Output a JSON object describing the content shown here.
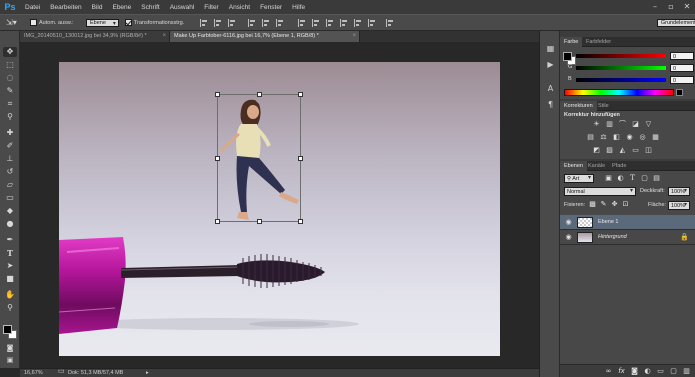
{
  "app": {
    "logo": "Ps",
    "menu": [
      "Datei",
      "Bearbeiten",
      "Bild",
      "Ebene",
      "Schrift",
      "Auswahl",
      "Filter",
      "Ansicht",
      "Fenster",
      "Hilfe"
    ],
    "window_controls": {
      "minimize": "–",
      "maximize": "▫",
      "close": "✕"
    }
  },
  "options_bar": {
    "auto_select_label": "Autom. ausw.:",
    "auto_select_checked": false,
    "auto_select_target": "Ebene",
    "transform_controls_label": "Transformationsstrg.",
    "transform_controls_checked": true,
    "workspace": "Grundelemente"
  },
  "tabs": [
    {
      "label": "IMG_20140510_130012.jpg bei 34,9% (RGB/8#) *",
      "close": "×",
      "active": false
    },
    {
      "label": "Make Up Farbtober-6116.jpg bei 16,7% (Ebene 1, RGB/8) *",
      "close": "×",
      "active": true
    }
  ],
  "status": {
    "zoom": "16,67%",
    "doc_info": "Dok: 51,3 MB/57,4 MB"
  },
  "color_panel": {
    "tabs": [
      "Farbe",
      "Farbfelder"
    ],
    "channels": [
      {
        "label": "R",
        "value": "0",
        "color": "#cc2222"
      },
      {
        "label": "G",
        "value": "0",
        "color": "#22aa22"
      },
      {
        "label": "B",
        "value": "0",
        "color": "#2244cc"
      }
    ]
  },
  "adjustments_panel": {
    "tabs": [
      "Korrekturen",
      "Stile"
    ],
    "title": "Korrektur hinzufügen",
    "row1": [
      "brightness-icon",
      "levels-icon",
      "curves-icon",
      "exposure-icon",
      "vibrance-icon"
    ],
    "row2": [
      "hue-saturation-icon",
      "color-balance-icon",
      "black-white-icon",
      "photo-filter-icon",
      "channel-mixer-icon",
      "color-lookup-icon"
    ],
    "row3": [
      "invert-icon",
      "posterize-icon",
      "threshold-icon",
      "gradient-map-icon",
      "selective-color-icon"
    ]
  },
  "layers_panel": {
    "tabs": [
      "Ebenen",
      "Kanäle",
      "Pfade"
    ],
    "filter_kind": "Art",
    "blend_mode": "Normal",
    "opacity_label": "Deckkraft:",
    "opacity_value": "100%",
    "lock_label": "Fixieren:",
    "fill_label": "Fläche:",
    "fill_value": "100%",
    "layers": [
      {
        "name": "Ebene 1",
        "selected": true,
        "locked": false
      },
      {
        "name": "Hintergrund",
        "selected": false,
        "locked": true
      }
    ],
    "footer_icons": [
      "link-icon",
      "fx-icon",
      "mask-icon",
      "adjustment-layer-icon",
      "group-icon",
      "new-layer-icon",
      "trash-icon"
    ]
  },
  "toolbar": {
    "tools": [
      "move-tool",
      "marquee-tool",
      "lasso-tool",
      "quick-select-tool",
      "crop-tool",
      "eyedropper-tool",
      "healing-brush-tool",
      "brush-tool",
      "clone-stamp-tool",
      "history-brush-tool",
      "eraser-tool",
      "gradient-tool",
      "blur-tool",
      "dodge-tool",
      "pen-tool",
      "type-tool",
      "path-select-tool",
      "shape-tool",
      "hand-tool",
      "zoom-tool"
    ]
  }
}
